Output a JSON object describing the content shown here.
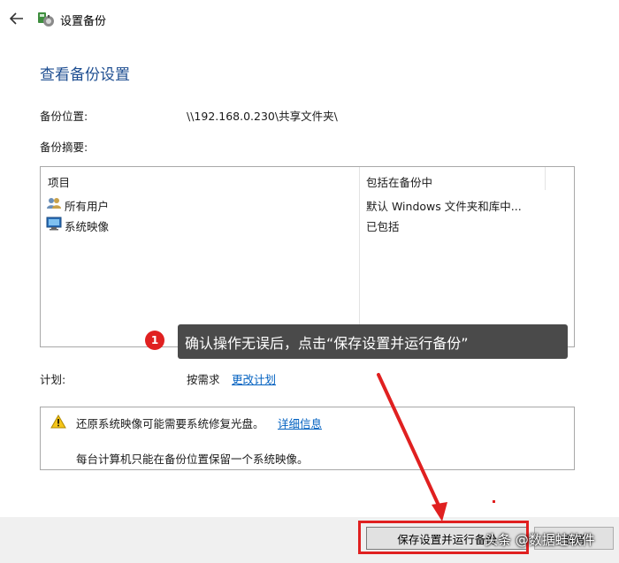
{
  "window": {
    "title": "设置备份"
  },
  "heading": "查看备份设置",
  "location": {
    "label": "备份位置:",
    "value": "\\\\192.168.0.230\\共享文件夹\\"
  },
  "summary": {
    "label": "备份摘要:",
    "columns": [
      "项目",
      "包括在备份中"
    ],
    "rows": [
      {
        "item": "所有用户",
        "included": "默认 Windows 文件夹和库中...",
        "icon": "users-icon"
      },
      {
        "item": "系统映像",
        "included": "已包括",
        "icon": "monitor-icon"
      }
    ]
  },
  "schedule": {
    "label": "计划:",
    "value": "按需求",
    "change_link": "更改计划"
  },
  "warning": {
    "text": "还原系统映像可能需要系统修复光盘。",
    "link": "详细信息",
    "note": "每台计算机只能在备份位置保留一个系统映像。"
  },
  "buttons": {
    "save_run": "保存设置并运行备份",
    "cancel": "取消"
  },
  "annotation": {
    "step": "1",
    "text": "确认操作无误后，点击“保存设置并运行备份”"
  },
  "watermark": "头条 @数据蛙软件",
  "colors": {
    "heading": "#1e4e91",
    "link": "#0060c0",
    "annotation_red": "#e02020",
    "tooltip_bg": "#4a4a4a"
  }
}
